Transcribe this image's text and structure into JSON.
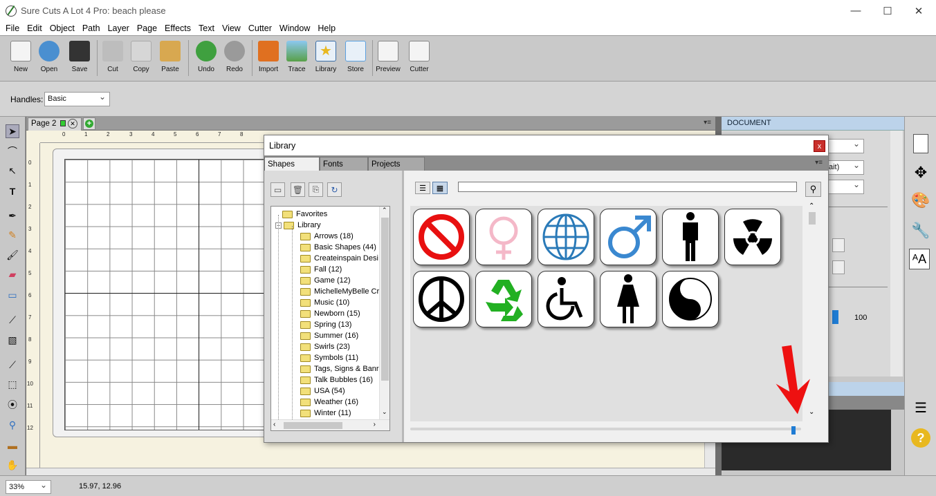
{
  "window": {
    "title": "Sure Cuts A Lot 4 Pro: beach please",
    "minimize_glyph": "—",
    "maximize_glyph": "☐",
    "close_glyph": "✕"
  },
  "menu": [
    "File",
    "Edit",
    "Object",
    "Path",
    "Layer",
    "Page",
    "Effects",
    "Text",
    "View",
    "Cutter",
    "Window",
    "Help"
  ],
  "toolbar": {
    "buttons": [
      {
        "label": "New",
        "icon": "new-document-icon",
        "color": "#f4f4f4"
      },
      {
        "label": "Open",
        "icon": "open-folder-icon",
        "color": "#4a8fd0"
      },
      {
        "label": "Save",
        "icon": "floppy-disk-icon",
        "color": "#333333"
      },
      {
        "label": "Cut",
        "icon": "scissors-icon",
        "color": "#bdbdbd"
      },
      {
        "label": "Copy",
        "icon": "copy-icon",
        "color": "#d6d6d6"
      },
      {
        "label": "Paste",
        "icon": "paste-clipboard-icon",
        "color": "#d8a850"
      },
      {
        "label": "Undo",
        "icon": "undo-arrow-icon",
        "color": "#3fa03f"
      },
      {
        "label": "Redo",
        "icon": "redo-arrow-icon",
        "color": "#9a9a9a"
      },
      {
        "label": "Import",
        "icon": "import-svg-icon",
        "color": "#e07020"
      },
      {
        "label": "Trace",
        "icon": "trace-landscape-icon",
        "color": "#58a048"
      },
      {
        "label": "Library",
        "icon": "library-star-icon",
        "color": "#e8c840"
      },
      {
        "label": "Store",
        "icon": "store-cart-icon",
        "color": "#5aa0e0"
      },
      {
        "label": "Preview",
        "icon": "preview-magnifier-icon",
        "color": "#f4f4f4"
      },
      {
        "label": "Cutter",
        "icon": "cutter-pen-icon",
        "color": "#f4f4f4"
      }
    ]
  },
  "options": {
    "handles_label": "Handles:",
    "handles_value": "Basic"
  },
  "page_tab": {
    "label": "Page 2"
  },
  "ruler": {
    "top": [
      "0",
      "1",
      "2",
      "3",
      "4",
      "5",
      "6",
      "7",
      "8"
    ],
    "left": [
      "0",
      "1",
      "2",
      "3",
      "4",
      "5",
      "6",
      "7",
      "8",
      "9",
      "10",
      "11",
      "12"
    ]
  },
  "library": {
    "title": "Library",
    "close": "x",
    "tabs": [
      "Shapes",
      "Fonts",
      "Projects"
    ],
    "tree": {
      "favorites": "Favorites",
      "library": "Library",
      "folders": [
        "Arrows (18)",
        "Basic Shapes (44)",
        "Createinspain Desi",
        "Fall (12)",
        "Game (12)",
        "MichelleMyBelle Cre",
        "Music (10)",
        "Newborn (15)",
        "Spring (13)",
        "Summer (16)",
        "Swirls (23)",
        "Symbols (11)",
        "Tags, Signs & Banr",
        "Talk Bubbles (16)",
        "USA (54)",
        "Weather (16)",
        "Winter (11)"
      ]
    },
    "search_value": "",
    "shapes": [
      "no-symbol-icon",
      "female-symbol-icon",
      "globe-icon",
      "male-symbol-icon",
      "man-figure-icon",
      "radiation-icon",
      "peace-icon",
      "recycle-icon",
      "wheelchair-icon",
      "woman-figure-icon",
      "yin-yang-icon"
    ]
  },
  "right_panel": {
    "header": "DOCUMENT",
    "select_tail": "ait)",
    "value_100": "100"
  },
  "status": {
    "zoom": "33%",
    "coords": "15.97, 12.96"
  },
  "colors": {
    "arrow": "#ee1111",
    "accent": "#1f7cd4",
    "panel_header": "#bcd3ea"
  }
}
